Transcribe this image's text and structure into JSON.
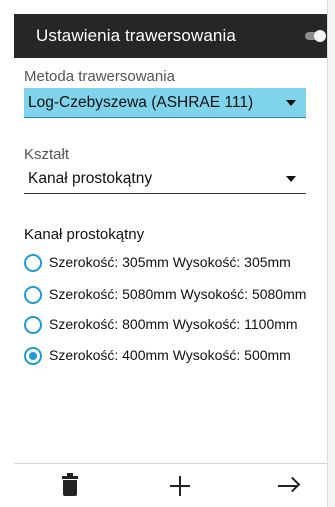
{
  "appbar": {
    "title": "Ustawienia trawersowania",
    "toggle_icon": "toggle-icon"
  },
  "method": {
    "label": "Metoda trawersowania",
    "selected": "Log-Czebyszewa (ASHRAE 111)",
    "highlight_color": "#7fd3ea"
  },
  "shape": {
    "label": "Kształt",
    "selected": "Kanał prostokątny"
  },
  "duct_group": {
    "title": "Kanał prostokątny",
    "options": [
      {
        "label": "Szerokość: 305mm Wysokość: 305mm",
        "checked": false
      },
      {
        "label": "Szerokość: 5080mm Wysokość: 5080mm",
        "checked": false
      },
      {
        "label": "Szerokość: 800mm Wysokość: 1100mm",
        "checked": false
      },
      {
        "label": "Szerokość: 400mm Wysokość: 500mm",
        "checked": true
      }
    ],
    "accent_color": "#1d9bd7"
  },
  "bottom_bar": {
    "icons": [
      "trash-icon",
      "plus-icon",
      "arrow-right-icon"
    ]
  }
}
